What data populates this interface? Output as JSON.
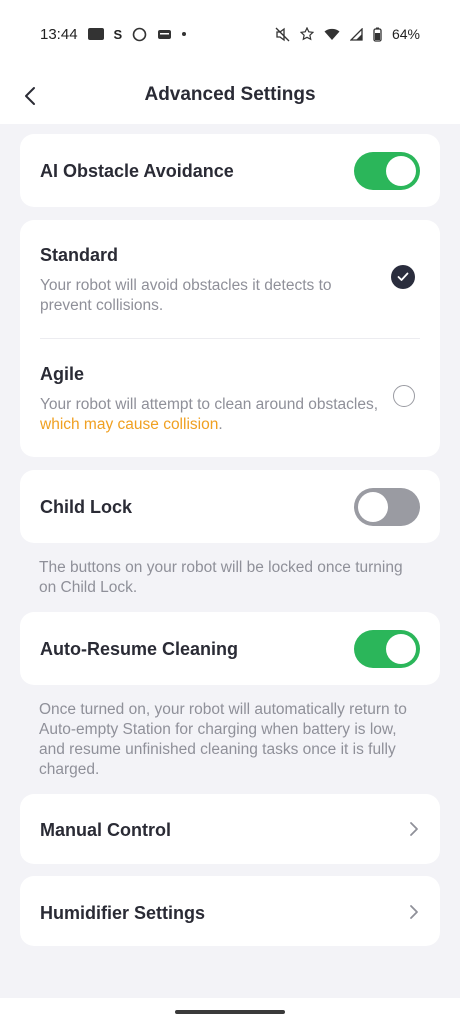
{
  "status_bar": {
    "time": "13:44",
    "battery": "64%",
    "s_glyph": "S",
    "icons": [
      "notification-chip-icon",
      "s-icon",
      "circle-icon",
      "wallet-icon",
      "dot-icon",
      "mute-icon",
      "star-icon",
      "wifi-icon",
      "signal-icon",
      "battery-icon"
    ]
  },
  "header": {
    "title": "Advanced Settings",
    "back_icon": "chevron-left-icon"
  },
  "ai_obstacle": {
    "label": "AI Obstacle Avoidance",
    "enabled": true
  },
  "avoidance_modes": {
    "standard": {
      "title": "Standard",
      "description": "Your robot will avoid obstacles it detects to prevent collisions.",
      "selected": true
    },
    "agile": {
      "title": "Agile",
      "description_plain": "Your robot will attempt to clean around obstacles, ",
      "description_warning": "which may cause collision",
      "description_end": ".",
      "selected": false
    }
  },
  "child_lock": {
    "label": "Child Lock",
    "enabled": false,
    "note": "The buttons on your robot will be locked once turning on Child Lock."
  },
  "auto_resume": {
    "label": "Auto-Resume Cleaning",
    "enabled": true,
    "note": "Once turned on, your robot will automatically return to Auto-empty Station for charging when battery is low, and resume unfinished cleaning tasks once it is fully charged."
  },
  "manual_control": {
    "label": "Manual Control"
  },
  "humidifier": {
    "label": "Humidifier Settings"
  },
  "colors": {
    "toggle_on": "#2bb65a",
    "toggle_off": "#9a9ba2",
    "warning": "#f0a021",
    "text_primary": "#2a2b35",
    "text_secondary": "#8f9099"
  }
}
